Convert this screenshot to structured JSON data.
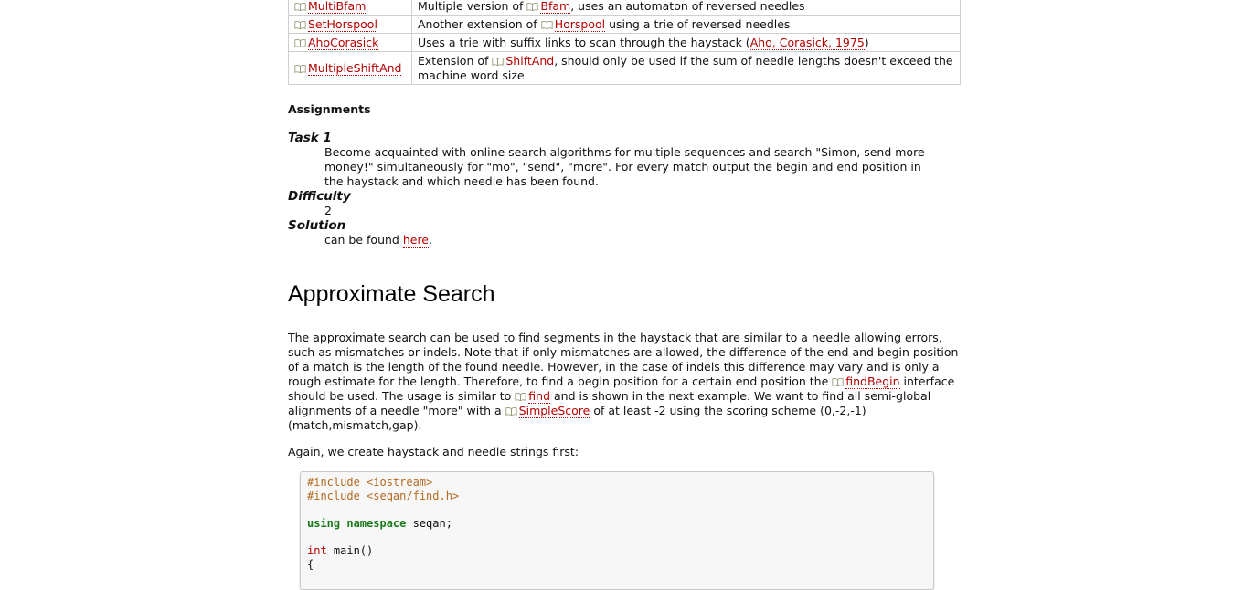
{
  "colors": {
    "link": "#b40000",
    "keyword": "#1a7a1a",
    "preprocessor": "#b46a1e",
    "type": "#b40000"
  },
  "table": {
    "rows": [
      {
        "name": "MultiBfam",
        "desc_before": "Multiple version of ",
        "desc_link": "Bfam",
        "desc_after": ", uses an automaton of reversed needles"
      },
      {
        "name": "SetHorspool",
        "desc_before": "Another extension of ",
        "desc_link": "Horspool",
        "desc_after": " using a trie of reversed needles"
      },
      {
        "name": "AhoCorasick",
        "desc_before": "Uses a trie with suffix links to scan through the haystack (",
        "desc_link": "Aho, Corasick, 1975",
        "desc_after": ")"
      },
      {
        "name": "MultipleShiftAnd",
        "desc_before": "Extension of ",
        "desc_link": "ShiftAnd",
        "desc_after": ", should only be used if the sum of needle lengths doesn't exceed the machine word size"
      }
    ]
  },
  "assignments": {
    "heading": "Assignments",
    "task_label": "Task 1",
    "task_text": "Become acquainted with online search algorithms for multiple sequences and search \"Simon, send more money!\" simultaneously for \"mo\", \"send\", \"more\". For every match output the begin and end position in the haystack and which needle has been found.",
    "difficulty_label": "Difficulty",
    "difficulty_value": "2",
    "solution_label": "Solution",
    "solution_before": "can be found ",
    "solution_link": "here",
    "solution_after": "."
  },
  "section": {
    "title": "Approximate Search",
    "p1_a": "The approximate search can be used to find segments in the haystack that are similar to a needle allowing errors, such as mismatches or indels. Note that if only mismatches are allowed, the difference of the end and begin position of a match is the length of the found needle. However, in the case of indels this difference may vary and is only a rough estimate for the length. Therefore, to find a begin position for a certain end position the ",
    "p1_link1": "findBegin",
    "p1_b": " interface should be used. The usage is similar to ",
    "p1_link2": "find",
    "p1_c": " and is shown in the next example. We want to find all semi-global alignments of a needle \"more\" with a ",
    "p1_link3": "SimpleScore",
    "p1_d": " of at least -2 using the scoring scheme (0,-2,-1) (match,mismatch,gap).",
    "p2": "Again, we create haystack and needle strings first:"
  },
  "code": {
    "line1": "#include <iostream>",
    "line2": "#include <seqan/find.h>",
    "line4_kw": "using namespace",
    "line4_rest": " seqan;",
    "line6_type": "int",
    "line6_rest": " main()",
    "line7": "{"
  }
}
